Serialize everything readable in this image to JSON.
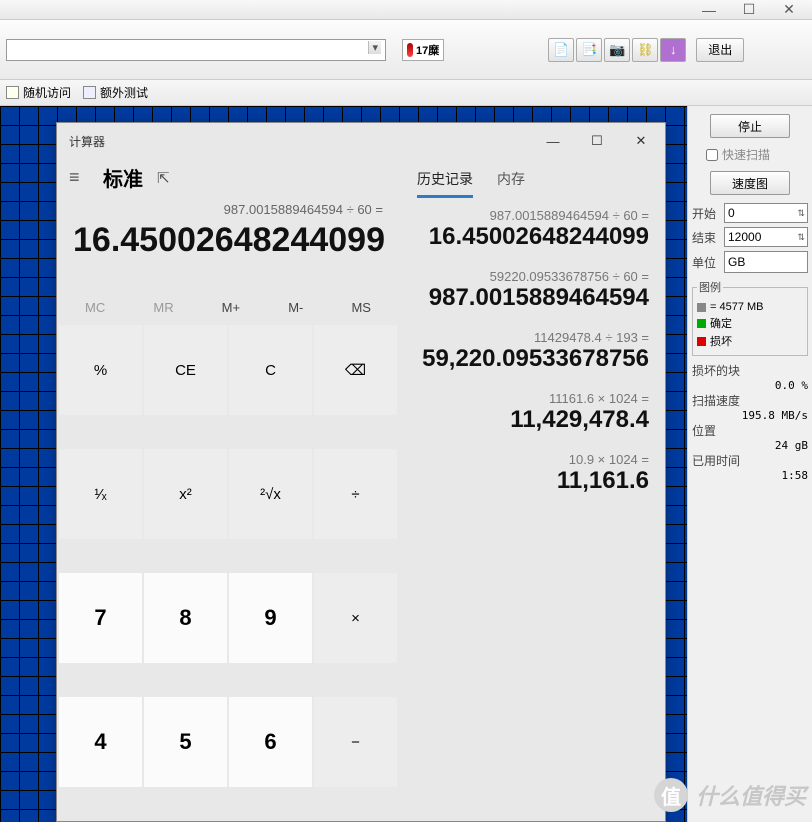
{
  "window_controls": {
    "min": "—",
    "max": "☐",
    "close": "✕"
  },
  "toolbar": {
    "temp_label": "17糜",
    "exit_label": "退出"
  },
  "secbar": {
    "random": "随机访问",
    "extra": "额外测试"
  },
  "rpanel": {
    "stop": "停止",
    "fastscan": "快速扫描",
    "speedmap": "速度图",
    "start_label": "开始",
    "start_val": "0",
    "end_label": "结束",
    "end_val": "12000",
    "unit_label": "单位",
    "unit_val": "GB",
    "legend_title": "图例",
    "legend1": "= 4577 MB",
    "legend2": "确定",
    "legend3": "损坏",
    "damaged_title": "损坏的块",
    "damaged_val": "0.0 %",
    "speed_title": "扫描速度",
    "speed_val": "195.8 MB/s",
    "pos_title": "位置",
    "pos_val": "24 gB",
    "elapsed_title": "已用时间",
    "elapsed_val": "1:58"
  },
  "calc": {
    "title": "计算器",
    "mode": "标准",
    "expr": "987.0015889464594 ÷ 60 =",
    "result": "16.45002648244099",
    "mem": [
      "MC",
      "MR",
      "M+",
      "M-",
      "MS"
    ],
    "keys_fn": [
      "%",
      "CE",
      "C",
      "⌫",
      "¹⁄ₓ",
      "x²",
      "²√x",
      "÷"
    ],
    "keys_num": [
      "7",
      "8",
      "9",
      "×",
      "4",
      "5",
      "6",
      "−"
    ],
    "tabs": {
      "history": "历史记录",
      "memory": "内存"
    },
    "history": [
      {
        "ex": "987.0015889464594   ÷   60 =",
        "rs": "16.45002648244099"
      },
      {
        "ex": "59220.09533678756   ÷   60 =",
        "rs": "987.0015889464594"
      },
      {
        "ex": "11429478.4   ÷   193 =",
        "rs": "59,220.09533678756"
      },
      {
        "ex": "11161.6   ×   1024 =",
        "rs": "11,429,478.4"
      },
      {
        "ex": "10.9   ×   1024 =",
        "rs": "11,161.6"
      }
    ]
  },
  "watermark": "什么值得买"
}
